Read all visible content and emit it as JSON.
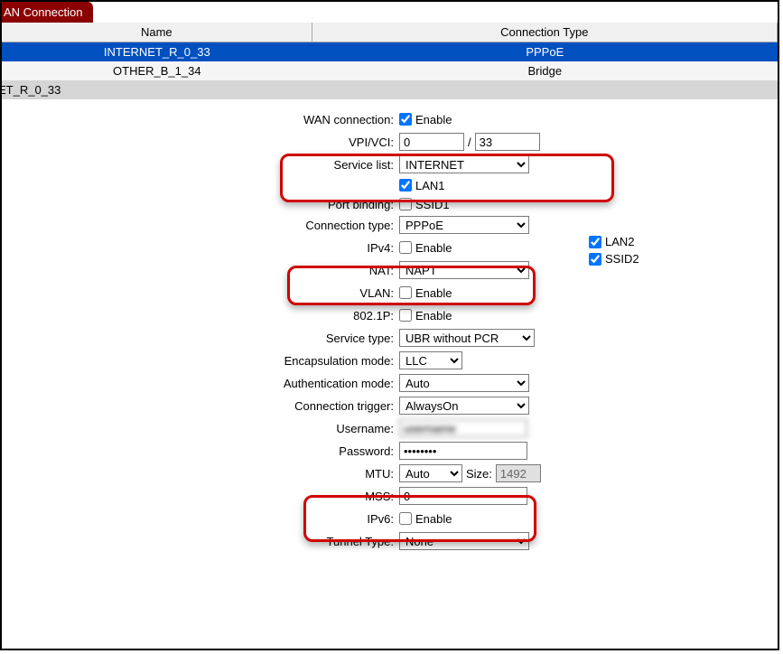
{
  "tab": {
    "label": "AN Connection"
  },
  "table": {
    "headers": {
      "name": "Name",
      "ctype": "Connection Type"
    },
    "rows": [
      {
        "name": "INTERNET_R_0_33",
        "ctype": "PPPoE",
        "selected": true
      },
      {
        "name": "OTHER_B_1_34",
        "ctype": "Bridge",
        "selected": false
      }
    ]
  },
  "section": {
    "title": "ET_R_0_33"
  },
  "form": {
    "wan_connection": {
      "label": "WAN connection:",
      "enable_text": "Enable",
      "checked": true
    },
    "vpi_vci": {
      "label": "VPI/VCI:",
      "vpi": "0",
      "sep": "/",
      "vci": "33"
    },
    "service_list": {
      "label": "Service list:",
      "value": "INTERNET"
    },
    "port_binding": {
      "label": "Port binding:",
      "lan1": {
        "text": "LAN1",
        "checked": true
      },
      "ssid1": {
        "text": "SSID1",
        "checked": false
      },
      "lan2": {
        "text": "LAN2",
        "checked": true
      },
      "ssid2": {
        "text": "SSID2",
        "checked": true
      }
    },
    "connection_type": {
      "label": "Connection type:",
      "value": "PPPoE"
    },
    "ipv4": {
      "label": "IPv4:",
      "enable_text": "Enable",
      "checked": false
    },
    "nat": {
      "label": "NAT:",
      "value": "NAPT"
    },
    "vlan": {
      "label": "VLAN:",
      "enable_text": "Enable",
      "checked": false
    },
    "p8021": {
      "label": "802.1P:",
      "enable_text": "Enable",
      "checked": false
    },
    "service_type": {
      "label": "Service type:",
      "value": "UBR without PCR"
    },
    "encapsulation": {
      "label": "Encapsulation mode:",
      "value": "LLC"
    },
    "auth_mode": {
      "label": "Authentication mode:",
      "value": "Auto"
    },
    "conn_trigger": {
      "label": "Connection trigger:",
      "value": "AlwaysOn"
    },
    "username": {
      "label": "Username:",
      "value": "username"
    },
    "password": {
      "label": "Password:",
      "value": "••••••••"
    },
    "mtu": {
      "label": "MTU:",
      "value": "Auto",
      "size_label": "Size:",
      "size_value": "1492"
    },
    "mss": {
      "label": "MSS:",
      "value": "0"
    },
    "ipv6": {
      "label": "IPv6:",
      "enable_text": "Enable",
      "checked": false
    },
    "tunnel": {
      "label": "Tunnel Type:",
      "value": "None"
    }
  }
}
